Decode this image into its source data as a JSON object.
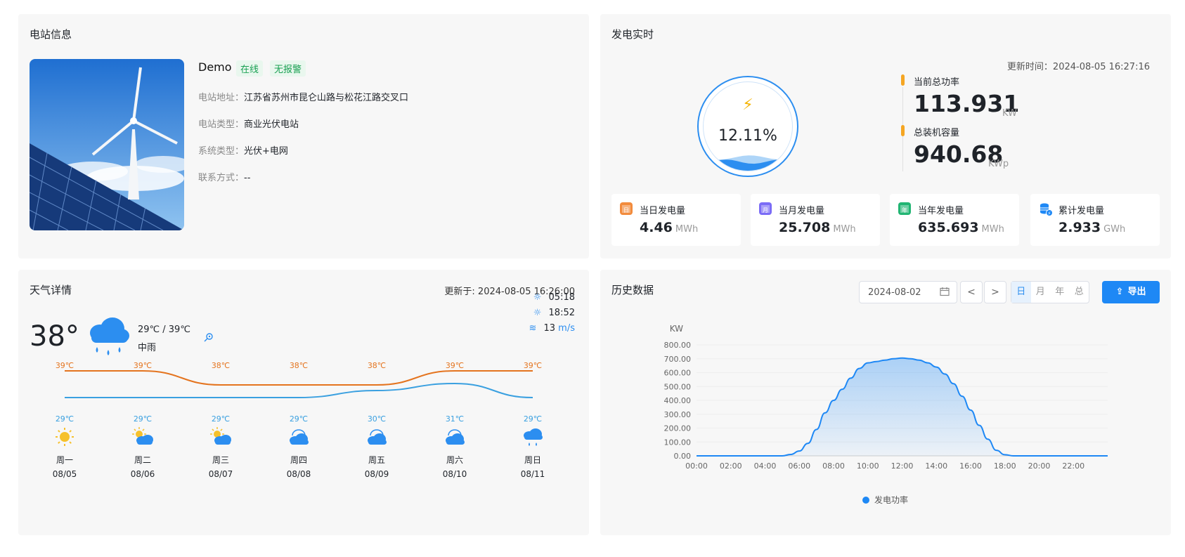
{
  "station": {
    "title": "电站信息",
    "name": "Demo",
    "tag_online": "在线",
    "tag_alarm": "无报警",
    "rows": [
      {
        "key": "电站地址：",
        "value": "江苏省苏州市昆仑山路与松花江路交叉口"
      },
      {
        "key": "电站类型：",
        "value": "商业光伏电站"
      },
      {
        "key": "系统类型：",
        "value": "光伏+电网"
      },
      {
        "key": "联系方式：",
        "value": "--"
      }
    ]
  },
  "realtime": {
    "title": "发电实时",
    "update": "更新时间：2024-08-05 16:27:16",
    "gauge_pct": "12.11%",
    "gauge_level": 0.1211,
    "power_label": "当前总功率",
    "power_value": "113.931",
    "power_unit": "KW",
    "capacity_label": "总装机容量",
    "capacity_value": "940.68",
    "capacity_unit": "KWp",
    "stats": [
      {
        "label": "当日发电量",
        "value": "4.46",
        "unit": "MWh",
        "icon": "calendar-day-icon",
        "icon_text": "日",
        "color": "#f28b3c"
      },
      {
        "label": "当月发电量",
        "value": "25.708",
        "unit": "MWh",
        "icon": "calendar-month-icon",
        "icon_text": "月",
        "color": "#7b6cf6"
      },
      {
        "label": "当年发电量",
        "value": "635.693",
        "unit": "MWh",
        "icon": "calendar-year-icon",
        "icon_text": "年",
        "color": "#22b573"
      },
      {
        "label": "累计发电量",
        "value": "2.933",
        "unit": "GWh",
        "icon": "database-energy-icon",
        "icon_text": "",
        "color": "#1e88f5"
      }
    ]
  },
  "weather": {
    "title": "天气详情",
    "update": "更新于: 2024-08-05 16:26:00",
    "temp": "38°",
    "range": "29℃ / 39℃",
    "desc": "中雨",
    "sunrise": "05:18",
    "sunset": "18:52",
    "wind_value": "13",
    "wind_unit": "m/s",
    "days": [
      {
        "hi": "39℃",
        "lo": "29℃",
        "hi_v": 39,
        "lo_v": 29,
        "icon": "sunny-icon",
        "name": "周一",
        "date": "08/05"
      },
      {
        "hi": "39℃",
        "lo": "29℃",
        "hi_v": 39,
        "lo_v": 29,
        "icon": "partly-cloudy-icon",
        "name": "周二",
        "date": "08/06"
      },
      {
        "hi": "38℃",
        "lo": "29℃",
        "hi_v": 38,
        "lo_v": 29,
        "icon": "partly-cloudy-icon",
        "name": "周三",
        "date": "08/07"
      },
      {
        "hi": "38℃",
        "lo": "29℃",
        "hi_v": 38,
        "lo_v": 29,
        "icon": "cloudy-icon",
        "name": "周四",
        "date": "08/08"
      },
      {
        "hi": "38℃",
        "lo": "30℃",
        "hi_v": 38,
        "lo_v": 30,
        "icon": "cloudy-icon",
        "name": "周五",
        "date": "08/09"
      },
      {
        "hi": "39℃",
        "lo": "31℃",
        "hi_v": 39,
        "lo_v": 31,
        "icon": "cloudy-icon",
        "name": "周六",
        "date": "08/10"
      },
      {
        "hi": "39℃",
        "lo": "29℃",
        "hi_v": 39,
        "lo_v": 29,
        "icon": "rain-icon",
        "name": "周日",
        "date": "08/11"
      }
    ]
  },
  "history": {
    "title": "历史数据",
    "date": "2024-08-02",
    "prev": "<",
    "next": ">",
    "segments": [
      "日",
      "月",
      "年",
      "总"
    ],
    "active_segment": 0,
    "export_label": "导出",
    "colors": {
      "line": "#1e88f5",
      "accent": "#1e88f5"
    }
  },
  "chart_data": {
    "type": "area",
    "ylabel": "KW",
    "ylim": [
      0,
      800
    ],
    "yticks": [
      "0.00",
      "100.00",
      "200.00",
      "300.00",
      "400.00",
      "500.00",
      "600.00",
      "700.00",
      "800.00"
    ],
    "xticks": [
      "00:00",
      "02:00",
      "04:00",
      "06:00",
      "08:00",
      "10:00",
      "12:00",
      "14:00",
      "16:00",
      "18:00",
      "20:00",
      "22:00"
    ],
    "grid": true,
    "legend": "bottom-center",
    "series": [
      {
        "name": "发电功率",
        "x_hours": [
          0,
          1,
          2,
          3,
          4,
          5,
          5.5,
          6,
          6.5,
          7,
          7.5,
          8,
          8.5,
          9,
          9.5,
          10,
          10.5,
          11,
          11.5,
          12,
          12.5,
          13,
          13.5,
          14,
          14.5,
          15,
          15.5,
          16,
          16.5,
          17,
          17.5,
          18,
          18.5,
          19,
          20,
          21,
          22,
          23,
          24
        ],
        "values": [
          0,
          0,
          0,
          0,
          0,
          0,
          10,
          35,
          90,
          190,
          310,
          400,
          480,
          560,
          630,
          670,
          680,
          690,
          700,
          705,
          700,
          690,
          670,
          640,
          590,
          520,
          430,
          330,
          220,
          120,
          40,
          8,
          0,
          0,
          0,
          0,
          0,
          0,
          0
        ]
      }
    ]
  }
}
